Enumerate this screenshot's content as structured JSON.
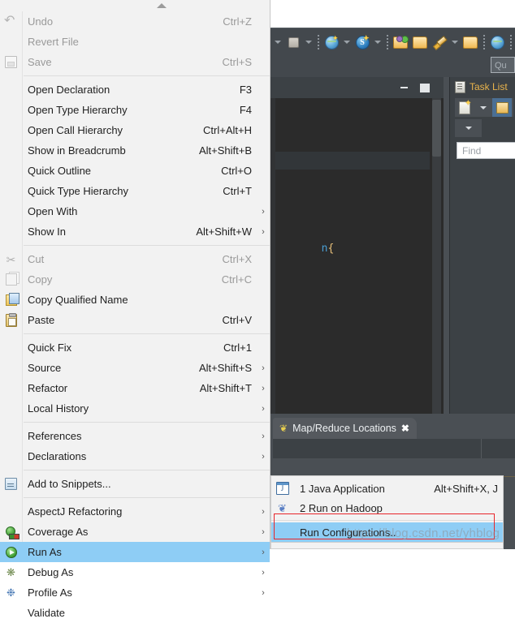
{
  "colors": {
    "menu_bg": "#f2f2f2",
    "menu_text": "#1f1f1f",
    "menu_disabled_text": "#9a9a9a",
    "highlight_blue": "#8ecdf5",
    "ide_dark": "#43484d",
    "editor_bg": "#2b2b2b",
    "accent_red_box": "#e8252a",
    "tasklist_title": "#e9b44c"
  },
  "toolbar": {
    "items": [
      {
        "name": "dropdown-caret-1",
        "type": "caret"
      },
      {
        "name": "gray-square-icon",
        "type": "icon"
      },
      {
        "name": "dropdown-caret-2",
        "type": "caret"
      },
      {
        "name": "separator-1",
        "type": "sep"
      },
      {
        "name": "globe-new-icon",
        "type": "icon"
      },
      {
        "name": "dropdown-caret-3",
        "type": "caret"
      },
      {
        "name": "svn-new-icon",
        "type": "icon"
      },
      {
        "name": "dropdown-caret-4",
        "type": "caret"
      },
      {
        "name": "separator-2",
        "type": "sep"
      },
      {
        "name": "open-folder-green-icon",
        "type": "icon"
      },
      {
        "name": "open-folder-icon",
        "type": "icon"
      },
      {
        "name": "pen-edit-icon",
        "type": "icon"
      },
      {
        "name": "dropdown-caret-5",
        "type": "caret"
      },
      {
        "name": "folder-pen-icon",
        "type": "icon"
      },
      {
        "name": "separator-3",
        "type": "sep"
      },
      {
        "name": "globe-icon",
        "type": "icon"
      },
      {
        "name": "separator-4",
        "type": "sep"
      }
    ],
    "quick_access_placeholder": "Qu"
  },
  "editor": {
    "minimize_label": "Minimize",
    "maximize_label": "Maximize",
    "code_fragment_type": "n",
    "code_fragment_brace": "{"
  },
  "task_list": {
    "title": "Task List",
    "find_placeholder": "Find",
    "buttons": [
      {
        "name": "new-task-button",
        "label": "New Task"
      },
      {
        "name": "new-task-dropdown",
        "label": "New Task Menu"
      },
      {
        "name": "categorize-button",
        "label": "Categorize"
      },
      {
        "name": "view-menu-button",
        "label": "View Menu"
      }
    ]
  },
  "map_reduce_view": {
    "tab_label": "Map/Reduce Locations",
    "close_label": "✖",
    "elephant_glyph": "❦"
  },
  "context_menu": {
    "scroll_up_label": "Scroll up",
    "groups": [
      {
        "items": [
          {
            "label": "Undo",
            "accel": "Ctrl+Z",
            "icon": "undo-icon",
            "disabled": true,
            "submenu": false
          },
          {
            "label": "Revert File",
            "accel": "",
            "icon": "",
            "disabled": true,
            "submenu": false
          },
          {
            "label": "Save",
            "accel": "Ctrl+S",
            "icon": "save-icon",
            "disabled": true,
            "submenu": false
          }
        ]
      },
      {
        "items": [
          {
            "label": "Open Declaration",
            "accel": "F3",
            "icon": "",
            "disabled": false,
            "submenu": false
          },
          {
            "label": "Open Type Hierarchy",
            "accel": "F4",
            "icon": "",
            "disabled": false,
            "submenu": false
          },
          {
            "label": "Open Call Hierarchy",
            "accel": "Ctrl+Alt+H",
            "icon": "",
            "disabled": false,
            "submenu": false
          },
          {
            "label": "Show in Breadcrumb",
            "accel": "Alt+Shift+B",
            "icon": "",
            "disabled": false,
            "submenu": false
          },
          {
            "label": "Quick Outline",
            "accel": "Ctrl+O",
            "icon": "",
            "disabled": false,
            "submenu": false
          },
          {
            "label": "Quick Type Hierarchy",
            "accel": "Ctrl+T",
            "icon": "",
            "disabled": false,
            "submenu": false
          },
          {
            "label": "Open With",
            "accel": "",
            "icon": "",
            "disabled": false,
            "submenu": true
          },
          {
            "label": "Show In",
            "accel": "Alt+Shift+W",
            "icon": "",
            "disabled": false,
            "submenu": true
          }
        ]
      },
      {
        "items": [
          {
            "label": "Cut",
            "accel": "Ctrl+X",
            "icon": "cut-icon",
            "disabled": true,
            "submenu": false
          },
          {
            "label": "Copy",
            "accel": "Ctrl+C",
            "icon": "copy-icon",
            "disabled": true,
            "submenu": false
          },
          {
            "label": "Copy Qualified Name",
            "accel": "",
            "icon": "copy-qualified-name-icon",
            "disabled": false,
            "submenu": false
          },
          {
            "label": "Paste",
            "accel": "Ctrl+V",
            "icon": "paste-icon",
            "disabled": false,
            "submenu": false
          }
        ]
      },
      {
        "items": [
          {
            "label": "Quick Fix",
            "accel": "Ctrl+1",
            "icon": "",
            "disabled": false,
            "submenu": false
          },
          {
            "label": "Source",
            "accel": "Alt+Shift+S",
            "icon": "",
            "disabled": false,
            "submenu": true
          },
          {
            "label": "Refactor",
            "accel": "Alt+Shift+T",
            "icon": "",
            "disabled": false,
            "submenu": true
          },
          {
            "label": "Local History",
            "accel": "",
            "icon": "",
            "disabled": false,
            "submenu": true
          }
        ]
      },
      {
        "items": [
          {
            "label": "References",
            "accel": "",
            "icon": "",
            "disabled": false,
            "submenu": true
          },
          {
            "label": "Declarations",
            "accel": "",
            "icon": "",
            "disabled": false,
            "submenu": true
          }
        ]
      },
      {
        "items": [
          {
            "label": "Add to Snippets...",
            "accel": "",
            "icon": "snippets-icon",
            "disabled": false,
            "submenu": false
          }
        ]
      },
      {
        "items": [
          {
            "label": "AspectJ Refactoring",
            "accel": "",
            "icon": "",
            "disabled": false,
            "submenu": true
          },
          {
            "label": "Coverage As",
            "accel": "",
            "icon": "coverage-icon",
            "disabled": false,
            "submenu": true
          },
          {
            "label": "Run As",
            "accel": "",
            "icon": "run-icon",
            "disabled": false,
            "submenu": true,
            "selected": true
          },
          {
            "label": "Debug As",
            "accel": "",
            "icon": "debug-icon",
            "disabled": false,
            "submenu": true
          },
          {
            "label": "Profile As",
            "accel": "",
            "icon": "profile-icon",
            "disabled": false,
            "submenu": true
          },
          {
            "label": "Validate",
            "accel": "",
            "icon": "",
            "disabled": false,
            "submenu": false
          }
        ]
      }
    ]
  },
  "run_as_submenu": {
    "items": [
      {
        "label": "1 Java Application",
        "accel": "Alt+Shift+X, J",
        "icon": "java-application-icon"
      },
      {
        "label": "2 Run on Hadoop",
        "accel": "",
        "icon": "hadoop-elephant-icon"
      }
    ],
    "run_configurations_label": "Run Configurations..",
    "hadoop_glyph": "❦"
  },
  "watermark": {
    "text": "https://blog.csdn.net/yhblog"
  }
}
